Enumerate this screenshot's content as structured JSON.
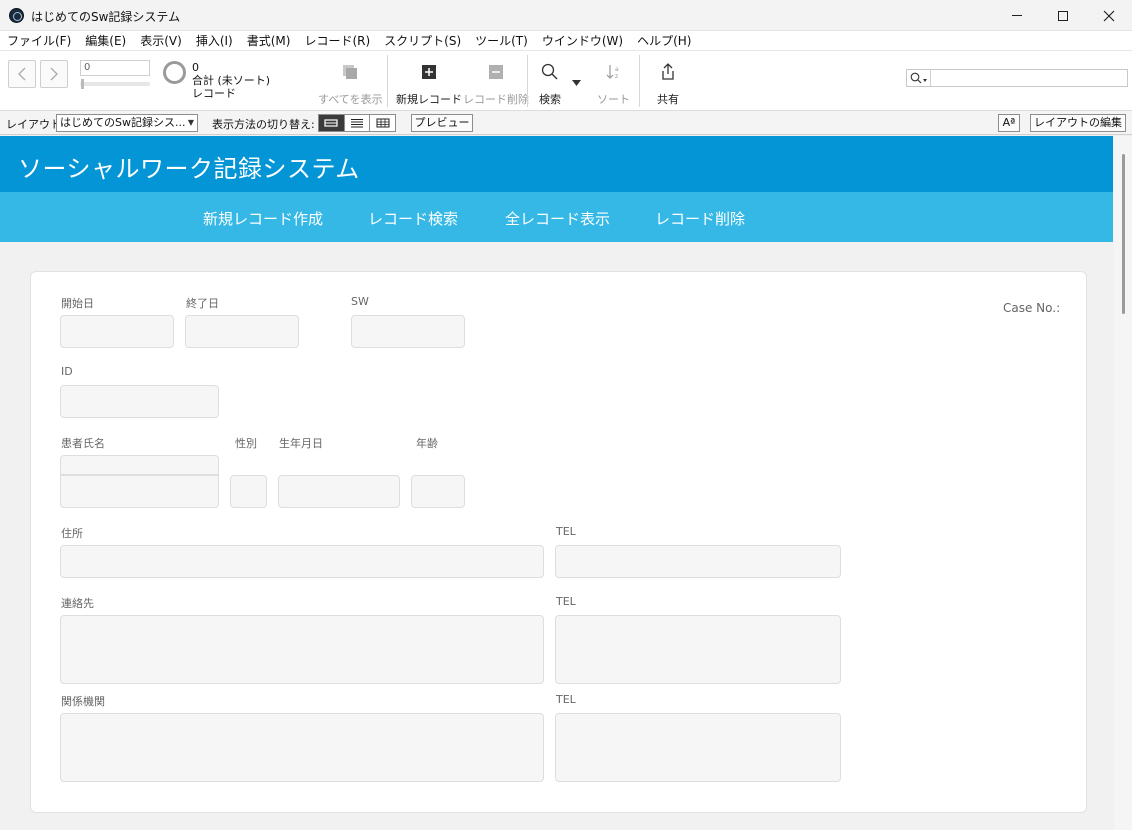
{
  "window": {
    "title": "はじめてのSw記録システム"
  },
  "menu": [
    "ファイル(F)",
    "編集(E)",
    "表示(V)",
    "挿入(I)",
    "書式(M)",
    "レコード(R)",
    "スクリプト(S)",
    "ツール(T)",
    "ウインドウ(W)",
    "ヘルプ(H)"
  ],
  "toolbar": {
    "record_input": "0",
    "record_count": "0",
    "total_label": "合計 (未ソート)",
    "record_label": "レコード",
    "show_all": "すべてを表示",
    "new_record": "新規レコード",
    "delete_record": "レコード削除",
    "find": "検索",
    "sort": "ソート",
    "share": "共有"
  },
  "layoutbar": {
    "layout_label": "レイアウト:",
    "layout_value": "はじめてのSw記録シス...",
    "view_as_label": "表示方法の切り替え:",
    "preview": "プレビュー",
    "aa": "Aª",
    "edit_layout": "レイアウトの編集"
  },
  "header": {
    "title": "ソーシャルワーク記録システム",
    "nav": [
      "新規レコード作成",
      "レコード検索",
      "全レコード表示",
      "レコード削除"
    ]
  },
  "form": {
    "case_no": "Case No.:",
    "start_date": "開始日",
    "end_date": "終了日",
    "sw": "SW",
    "id": "ID",
    "patient_name": "患者氏名",
    "gender": "性別",
    "birth_date": "生年月日",
    "age": "年齢",
    "address": "住所",
    "tel": "TEL",
    "contact": "連絡先",
    "agencies": "関係機関"
  },
  "colors": {
    "header": "#0395d6",
    "nav": "#35b8e6"
  }
}
